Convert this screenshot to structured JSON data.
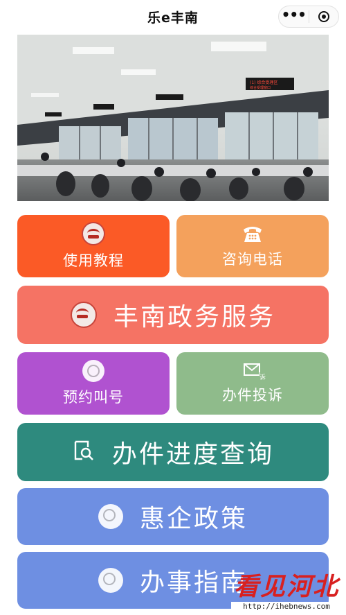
{
  "nav": {
    "title": "乐e丰南",
    "more_icon": "more-dots-icon",
    "close_icon": "target-close-icon"
  },
  "banner": {
    "image": "service-hall-photo",
    "signs": [
      "(1) 综合受理区",
      "综合受理窗口"
    ]
  },
  "tiles": {
    "tutorial": {
      "label": "使用教程",
      "icon": "emblem-icon"
    },
    "hotline": {
      "label": "咨询电话",
      "icon": "telephone-icon"
    },
    "gov_service": {
      "label": "丰南政务服务",
      "icon": "emblem-icon"
    },
    "appointment": {
      "label": "预约叫号",
      "icon": "clock-icon"
    },
    "complaint": {
      "label": "办件投诉",
      "icon": "complaint-mail-icon",
      "icon_text": "诉"
    },
    "progress": {
      "label": "办件进度查询",
      "icon": "search-doc-icon"
    },
    "policy": {
      "label": "惠企政策",
      "icon": "clock-icon"
    },
    "guide": {
      "label": "办事指南",
      "icon": "clock-icon"
    }
  },
  "watermark": {
    "title": "看见河北",
    "url": "http://ihebnews.com"
  },
  "colors": {
    "tutorial": "#fb5a26",
    "hotline": "#f4a15c",
    "gov_service": "#f57364",
    "appointment": "#b052d0",
    "complaint": "#8fbb8b",
    "progress": "#2e8a7e",
    "policy": "#6e8fe2",
    "guide": "#6e8fe2"
  }
}
